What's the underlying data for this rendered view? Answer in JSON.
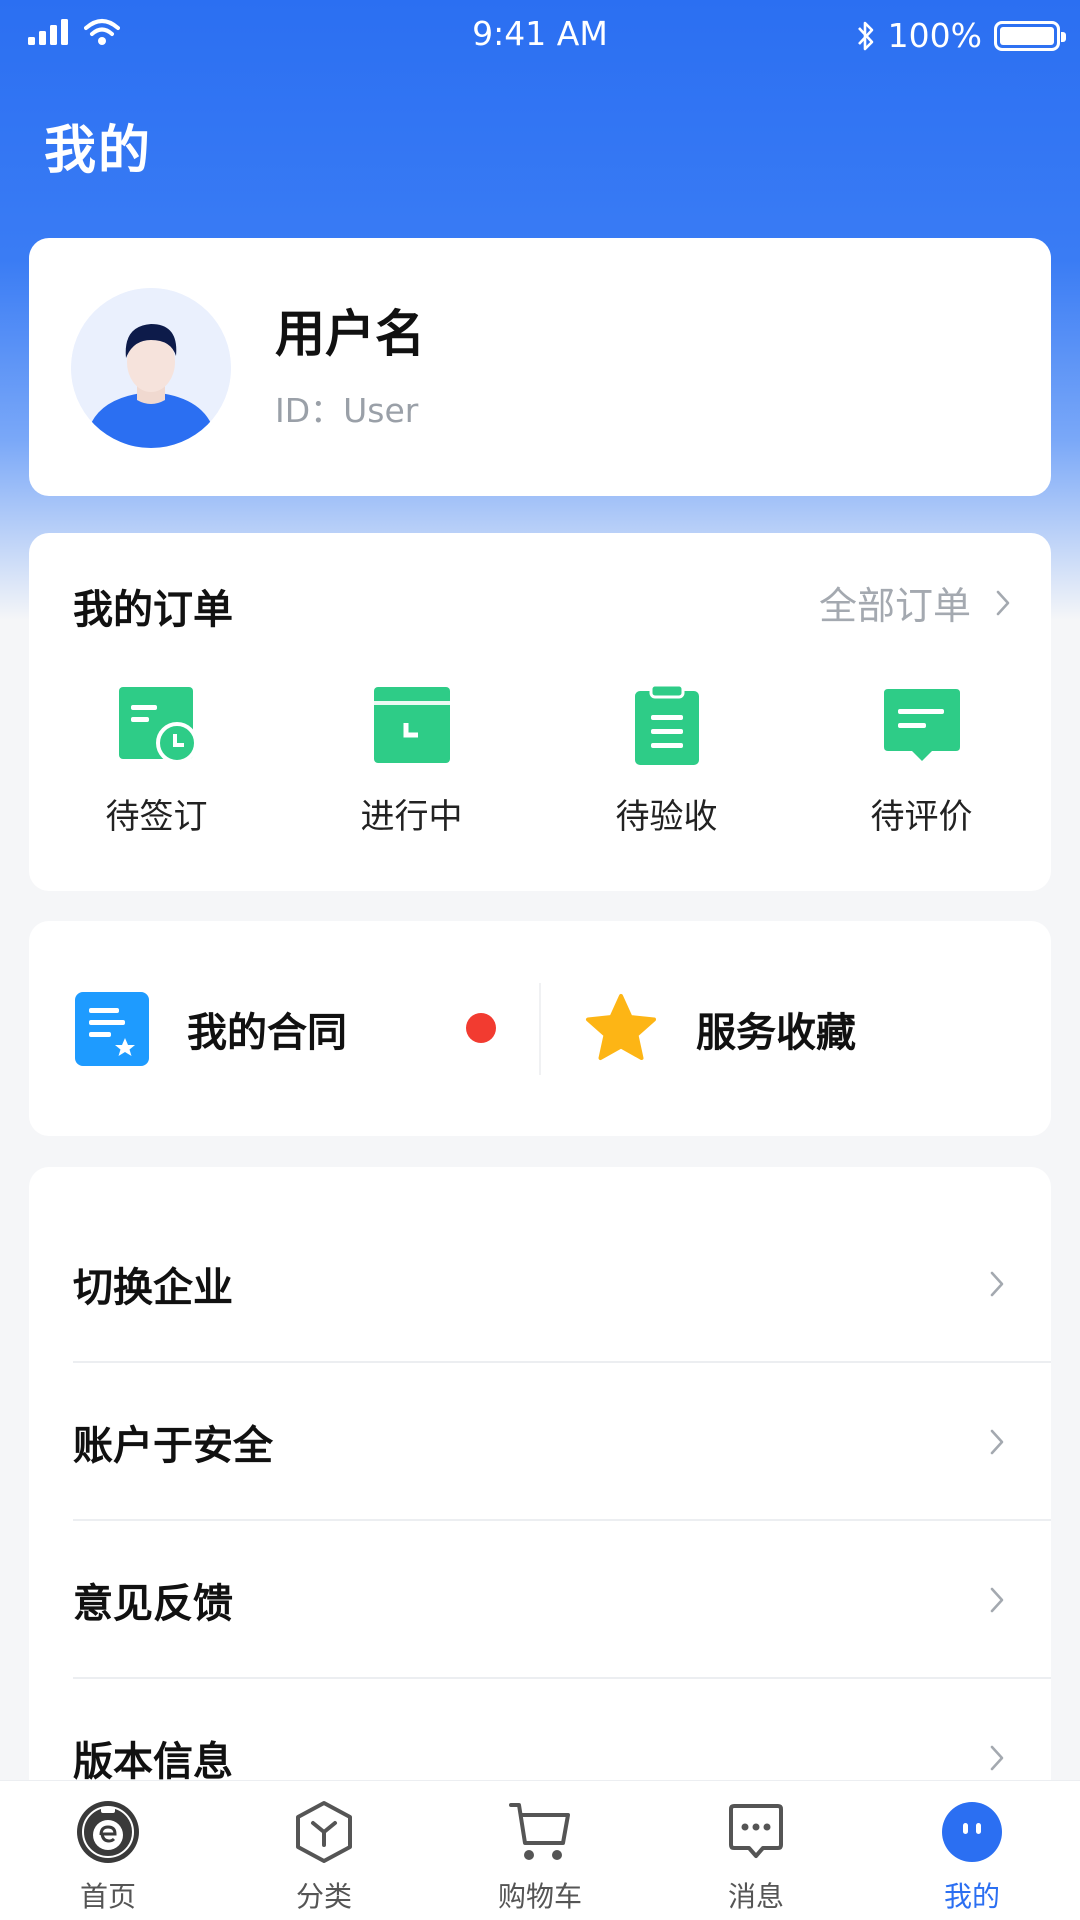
{
  "status_bar": {
    "time": "9:41 AM",
    "battery": "100%"
  },
  "header": {
    "title": "我的"
  },
  "profile": {
    "username": "用户名",
    "id_text": "ID：User"
  },
  "orders": {
    "title": "我的订单",
    "all_label": "全部订单",
    "items": [
      {
        "label": "待签订",
        "icon": "pending-sign-icon"
      },
      {
        "label": "进行中",
        "icon": "in-progress-icon"
      },
      {
        "label": "待验收",
        "icon": "pending-acceptance-icon"
      },
      {
        "label": "待评价",
        "icon": "pending-review-icon"
      }
    ]
  },
  "shortcuts": {
    "contract_label": "我的合同",
    "favorites_label": "服务收藏"
  },
  "settings": [
    {
      "label": "切换企业"
    },
    {
      "label": "账户于安全"
    },
    {
      "label": "意见反馈"
    },
    {
      "label": "版本信息"
    }
  ],
  "tabs": [
    {
      "label": "首页",
      "icon": "home-logo-icon"
    },
    {
      "label": "分类",
      "icon": "category-icon"
    },
    {
      "label": "购物车",
      "icon": "cart-icon"
    },
    {
      "label": "消息",
      "icon": "message-icon"
    },
    {
      "label": "我的",
      "icon": "profile-icon",
      "active": true
    }
  ],
  "colors": {
    "brand_blue": "#2b6ff2",
    "order_green": "#2ecc87",
    "contract_blue": "#1e9bff",
    "star_yellow": "#fdb515",
    "notice_red": "#f23b30"
  }
}
